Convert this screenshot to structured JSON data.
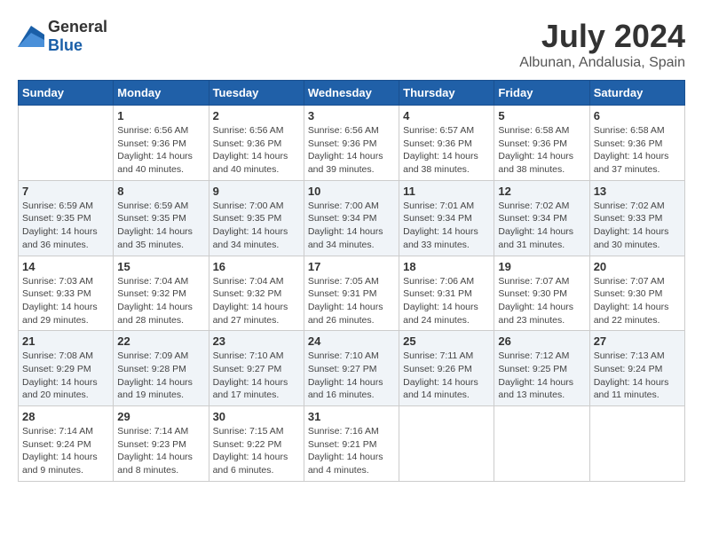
{
  "logo": {
    "general": "General",
    "blue": "Blue"
  },
  "title": "July 2024",
  "subtitle": "Albunan, Andalusia, Spain",
  "weekdays": [
    "Sunday",
    "Monday",
    "Tuesday",
    "Wednesday",
    "Thursday",
    "Friday",
    "Saturday"
  ],
  "weeks": [
    [
      {
        "day": "",
        "sunrise": "",
        "sunset": "",
        "daylight": ""
      },
      {
        "day": "1",
        "sunrise": "Sunrise: 6:56 AM",
        "sunset": "Sunset: 9:36 PM",
        "daylight": "Daylight: 14 hours and 40 minutes."
      },
      {
        "day": "2",
        "sunrise": "Sunrise: 6:56 AM",
        "sunset": "Sunset: 9:36 PM",
        "daylight": "Daylight: 14 hours and 40 minutes."
      },
      {
        "day": "3",
        "sunrise": "Sunrise: 6:56 AM",
        "sunset": "Sunset: 9:36 PM",
        "daylight": "Daylight: 14 hours and 39 minutes."
      },
      {
        "day": "4",
        "sunrise": "Sunrise: 6:57 AM",
        "sunset": "Sunset: 9:36 PM",
        "daylight": "Daylight: 14 hours and 38 minutes."
      },
      {
        "day": "5",
        "sunrise": "Sunrise: 6:58 AM",
        "sunset": "Sunset: 9:36 PM",
        "daylight": "Daylight: 14 hours and 38 minutes."
      },
      {
        "day": "6",
        "sunrise": "Sunrise: 6:58 AM",
        "sunset": "Sunset: 9:36 PM",
        "daylight": "Daylight: 14 hours and 37 minutes."
      }
    ],
    [
      {
        "day": "7",
        "sunrise": "Sunrise: 6:59 AM",
        "sunset": "Sunset: 9:35 PM",
        "daylight": "Daylight: 14 hours and 36 minutes."
      },
      {
        "day": "8",
        "sunrise": "Sunrise: 6:59 AM",
        "sunset": "Sunset: 9:35 PM",
        "daylight": "Daylight: 14 hours and 35 minutes."
      },
      {
        "day": "9",
        "sunrise": "Sunrise: 7:00 AM",
        "sunset": "Sunset: 9:35 PM",
        "daylight": "Daylight: 14 hours and 34 minutes."
      },
      {
        "day": "10",
        "sunrise": "Sunrise: 7:00 AM",
        "sunset": "Sunset: 9:34 PM",
        "daylight": "Daylight: 14 hours and 34 minutes."
      },
      {
        "day": "11",
        "sunrise": "Sunrise: 7:01 AM",
        "sunset": "Sunset: 9:34 PM",
        "daylight": "Daylight: 14 hours and 33 minutes."
      },
      {
        "day": "12",
        "sunrise": "Sunrise: 7:02 AM",
        "sunset": "Sunset: 9:34 PM",
        "daylight": "Daylight: 14 hours and 31 minutes."
      },
      {
        "day": "13",
        "sunrise": "Sunrise: 7:02 AM",
        "sunset": "Sunset: 9:33 PM",
        "daylight": "Daylight: 14 hours and 30 minutes."
      }
    ],
    [
      {
        "day": "14",
        "sunrise": "Sunrise: 7:03 AM",
        "sunset": "Sunset: 9:33 PM",
        "daylight": "Daylight: 14 hours and 29 minutes."
      },
      {
        "day": "15",
        "sunrise": "Sunrise: 7:04 AM",
        "sunset": "Sunset: 9:32 PM",
        "daylight": "Daylight: 14 hours and 28 minutes."
      },
      {
        "day": "16",
        "sunrise": "Sunrise: 7:04 AM",
        "sunset": "Sunset: 9:32 PM",
        "daylight": "Daylight: 14 hours and 27 minutes."
      },
      {
        "day": "17",
        "sunrise": "Sunrise: 7:05 AM",
        "sunset": "Sunset: 9:31 PM",
        "daylight": "Daylight: 14 hours and 26 minutes."
      },
      {
        "day": "18",
        "sunrise": "Sunrise: 7:06 AM",
        "sunset": "Sunset: 9:31 PM",
        "daylight": "Daylight: 14 hours and 24 minutes."
      },
      {
        "day": "19",
        "sunrise": "Sunrise: 7:07 AM",
        "sunset": "Sunset: 9:30 PM",
        "daylight": "Daylight: 14 hours and 23 minutes."
      },
      {
        "day": "20",
        "sunrise": "Sunrise: 7:07 AM",
        "sunset": "Sunset: 9:30 PM",
        "daylight": "Daylight: 14 hours and 22 minutes."
      }
    ],
    [
      {
        "day": "21",
        "sunrise": "Sunrise: 7:08 AM",
        "sunset": "Sunset: 9:29 PM",
        "daylight": "Daylight: 14 hours and 20 minutes."
      },
      {
        "day": "22",
        "sunrise": "Sunrise: 7:09 AM",
        "sunset": "Sunset: 9:28 PM",
        "daylight": "Daylight: 14 hours and 19 minutes."
      },
      {
        "day": "23",
        "sunrise": "Sunrise: 7:10 AM",
        "sunset": "Sunset: 9:27 PM",
        "daylight": "Daylight: 14 hours and 17 minutes."
      },
      {
        "day": "24",
        "sunrise": "Sunrise: 7:10 AM",
        "sunset": "Sunset: 9:27 PM",
        "daylight": "Daylight: 14 hours and 16 minutes."
      },
      {
        "day": "25",
        "sunrise": "Sunrise: 7:11 AM",
        "sunset": "Sunset: 9:26 PM",
        "daylight": "Daylight: 14 hours and 14 minutes."
      },
      {
        "day": "26",
        "sunrise": "Sunrise: 7:12 AM",
        "sunset": "Sunset: 9:25 PM",
        "daylight": "Daylight: 14 hours and 13 minutes."
      },
      {
        "day": "27",
        "sunrise": "Sunrise: 7:13 AM",
        "sunset": "Sunset: 9:24 PM",
        "daylight": "Daylight: 14 hours and 11 minutes."
      }
    ],
    [
      {
        "day": "28",
        "sunrise": "Sunrise: 7:14 AM",
        "sunset": "Sunset: 9:24 PM",
        "daylight": "Daylight: 14 hours and 9 minutes."
      },
      {
        "day": "29",
        "sunrise": "Sunrise: 7:14 AM",
        "sunset": "Sunset: 9:23 PM",
        "daylight": "Daylight: 14 hours and 8 minutes."
      },
      {
        "day": "30",
        "sunrise": "Sunrise: 7:15 AM",
        "sunset": "Sunset: 9:22 PM",
        "daylight": "Daylight: 14 hours and 6 minutes."
      },
      {
        "day": "31",
        "sunrise": "Sunrise: 7:16 AM",
        "sunset": "Sunset: 9:21 PM",
        "daylight": "Daylight: 14 hours and 4 minutes."
      },
      {
        "day": "",
        "sunrise": "",
        "sunset": "",
        "daylight": ""
      },
      {
        "day": "",
        "sunrise": "",
        "sunset": "",
        "daylight": ""
      },
      {
        "day": "",
        "sunrise": "",
        "sunset": "",
        "daylight": ""
      }
    ]
  ]
}
